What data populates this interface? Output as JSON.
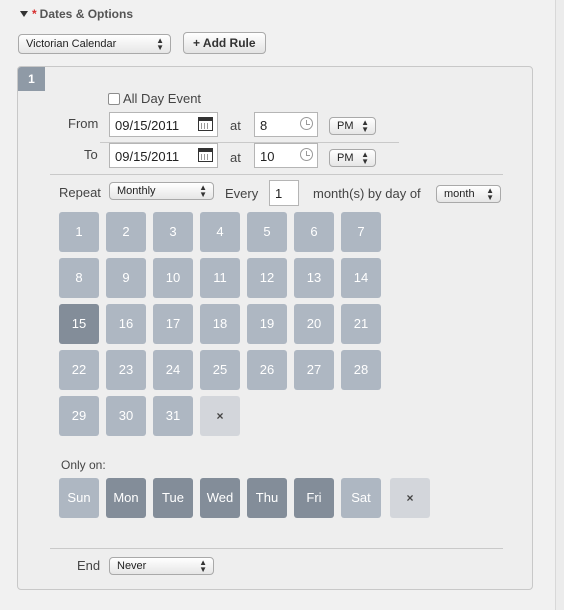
{
  "section": {
    "title": "Dates & Options",
    "required_mark": "*"
  },
  "calendar_select": {
    "value": "Victorian Calendar"
  },
  "add_rule": {
    "label": "+ Add Rule"
  },
  "rule": {
    "number": "1",
    "all_day_label": "All Day Event",
    "from_label": "From",
    "to_label": "To",
    "at_label": "at",
    "from_date": "09/15/2011",
    "from_hour": "8",
    "from_ampm": "PM",
    "to_date": "09/15/2011",
    "to_hour": "10",
    "to_ampm": "PM",
    "repeat_label": "Repeat",
    "repeat_value": "Monthly",
    "every_label": "Every",
    "every_value": "1",
    "by_label": "month(s) by day of",
    "by_value": "month",
    "month_days": [
      "1",
      "2",
      "3",
      "4",
      "5",
      "6",
      "7",
      "8",
      "9",
      "10",
      "11",
      "12",
      "13",
      "14",
      "15",
      "16",
      "17",
      "18",
      "19",
      "20",
      "21",
      "22",
      "23",
      "24",
      "25",
      "26",
      "27",
      "28",
      "29",
      "30",
      "31"
    ],
    "selected_day": "15",
    "clear_symbol": "×",
    "only_on_label": "Only on:",
    "weekdays": [
      "Sun",
      "Mon",
      "Tue",
      "Wed",
      "Thu",
      "Fri",
      "Sat"
    ],
    "weekdays_on": [
      "Mon",
      "Tue",
      "Wed",
      "Thu",
      "Fri"
    ],
    "end_label": "End",
    "end_value": "Never"
  },
  "colors": {
    "day_tile": "#aeb7c2",
    "day_selected": "#838d99",
    "clear_tile": "#d3d6db",
    "badge": "#8f9aa6"
  },
  "icons": {
    "collapse": "triangle-down-icon",
    "calendar": "calendar-icon",
    "clock": "clock-icon",
    "clear": "x-icon",
    "dropdown": "updown-arrows-icon"
  }
}
